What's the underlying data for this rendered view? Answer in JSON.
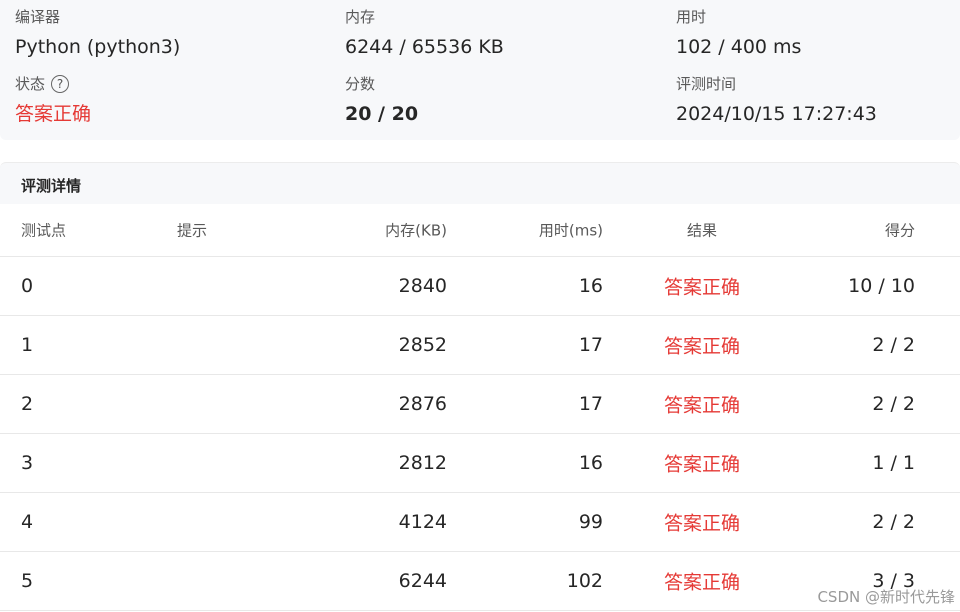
{
  "summary": {
    "compiler": {
      "label": "编译器",
      "value": "Python (python3)"
    },
    "memory": {
      "label": "内存",
      "value": "6244 / 65536 KB"
    },
    "time": {
      "label": "用时",
      "value": "102 / 400 ms"
    },
    "status": {
      "label": "状态",
      "help_icon": "?",
      "value": "答案正确"
    },
    "score": {
      "label": "分数",
      "value": "20 / 20"
    },
    "judge_time": {
      "label": "评测时间",
      "value": "2024/10/15 17:27:43"
    }
  },
  "detail": {
    "title": "评测详情",
    "columns": {
      "id": "测试点",
      "hint": "提示",
      "memory": "内存(KB)",
      "time": "用时(ms)",
      "result": "结果",
      "score": "得分"
    },
    "rows": [
      {
        "id": "0",
        "hint": "",
        "memory": "2840",
        "time": "16",
        "result": "答案正确",
        "score": "10 / 10"
      },
      {
        "id": "1",
        "hint": "",
        "memory": "2852",
        "time": "17",
        "result": "答案正确",
        "score": "2 / 2"
      },
      {
        "id": "2",
        "hint": "",
        "memory": "2876",
        "time": "17",
        "result": "答案正确",
        "score": "2 / 2"
      },
      {
        "id": "3",
        "hint": "",
        "memory": "2812",
        "time": "16",
        "result": "答案正确",
        "score": "1 / 1"
      },
      {
        "id": "4",
        "hint": "",
        "memory": "4124",
        "time": "99",
        "result": "答案正确",
        "score": "2 / 2"
      },
      {
        "id": "5",
        "hint": "",
        "memory": "6244",
        "time": "102",
        "result": "答案正确",
        "score": "3 / 3"
      }
    ]
  },
  "watermark": "CSDN @新时代先锋",
  "colors": {
    "accepted": "#e53935"
  }
}
